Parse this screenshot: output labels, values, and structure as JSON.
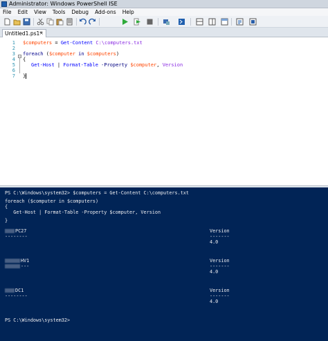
{
  "window": {
    "title": "Administrator: Windows PowerShell ISE"
  },
  "menu": [
    "File",
    "Edit",
    "View",
    "Tools",
    "Debug",
    "Add-ons",
    "Help"
  ],
  "toolbar": {
    "icons": [
      "new-icon",
      "open-icon",
      "save-icon",
      "cut-icon",
      "copy-icon",
      "paste-icon",
      "clear-icon",
      "undo-icon",
      "redo-icon",
      "run-icon",
      "run-selection-icon",
      "stop-icon",
      "remote-icon",
      "powershell-icon",
      "pane-top-icon",
      "pane-right-icon",
      "pane-max-icon",
      "show-command-icon",
      "addon-icon"
    ]
  },
  "tab": {
    "label": "Untitled1.ps1*",
    "close": "×"
  },
  "editor": {
    "line_numbers": [
      "1",
      "2",
      "3",
      "4",
      "5",
      "6",
      "7"
    ],
    "line1": {
      "var": "$computers",
      "eq": " = ",
      "cmd": "Get-Content",
      "path": " C:\\computers.txt"
    },
    "line3": {
      "kw": "foreach",
      "p1": " (",
      "var1": "$computer",
      "in": " in ",
      "var2": "$computers",
      "p2": ")"
    },
    "line4": "{",
    "line5": {
      "cmd1": "Get-Host",
      "pipe": " | ",
      "cmd2": "Format-Table",
      "param": " -Property ",
      "var": "$computer",
      "sep": ", ",
      "arg": "Version"
    },
    "line7": "}",
    "fold": "−"
  },
  "console": {
    "prompt1": "PS C:\\Windows\\system32> $computers = Get-Content C:\\computers.txt",
    "echo1": "foreach ($computer in $computers)",
    "echo2": "{",
    "echo3": "   Get-Host | Format-Table -Property $computer, Version",
    "echo4": "}",
    "results": [
      {
        "name": "PC27",
        "dash": "--------",
        "version_header": "Version",
        "version_dash": "-------",
        "version": "4.0"
      },
      {
        "name": "HV1",
        "dash": "---",
        "version_header": "Version",
        "version_dash": "-------",
        "version": "4.0"
      },
      {
        "name": "DC1",
        "dash": "--------",
        "version_header": "Version",
        "version_dash": "-------",
        "version": "4.0"
      }
    ],
    "prompt2": "PS C:\\Windows\\system32>"
  },
  "colors": {
    "console_bg": "#012456",
    "editor_bg": "#ffffff",
    "variable": "#ff4500",
    "keyword": "#00008b",
    "cmdlet": "#0000ff",
    "string": "#8a2be2"
  }
}
